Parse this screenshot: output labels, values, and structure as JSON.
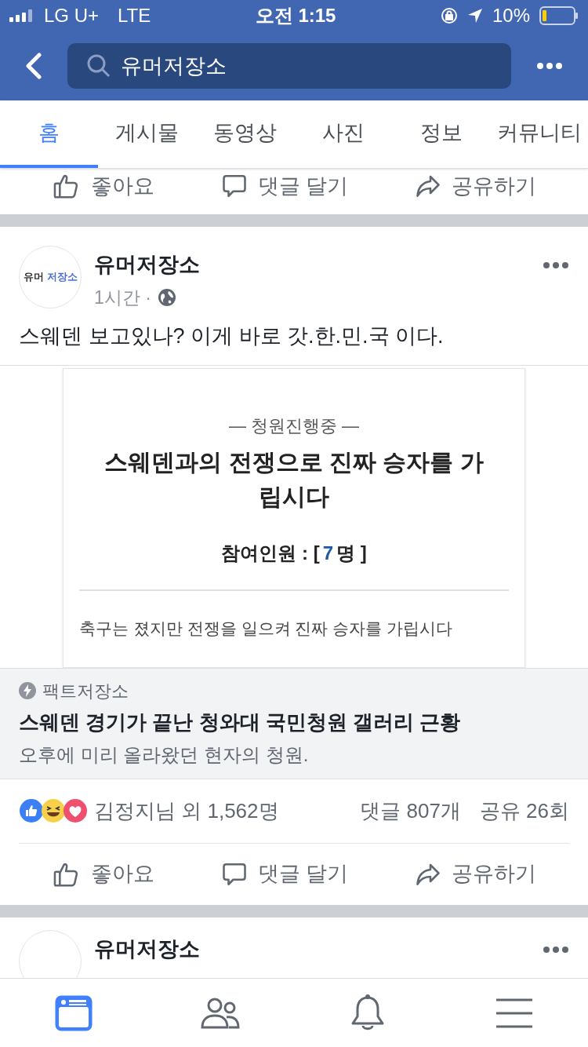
{
  "status_bar": {
    "carrier": "LG U+",
    "network": "LTE",
    "time": "오전 1:15",
    "battery": "10%"
  },
  "search": {
    "value": "유머저장소"
  },
  "tabs": [
    {
      "label": "홈",
      "selected": true
    },
    {
      "label": "게시물",
      "selected": false
    },
    {
      "label": "동영상",
      "selected": false
    },
    {
      "label": "사진",
      "selected": false
    },
    {
      "label": "정보",
      "selected": false
    },
    {
      "label": "커뮤니티",
      "selected": false
    }
  ],
  "previous_actions": [
    {
      "kind": "like",
      "label": "좋아요"
    },
    {
      "kind": "comment",
      "label": "댓글 달기"
    },
    {
      "kind": "share",
      "label": "공유하기"
    }
  ],
  "post": {
    "avatar": {
      "left": "유머",
      "right": "저장소"
    },
    "page_name": "유머저장소",
    "time": "1시간 ·",
    "text": "스웨덴 보고있나? 이게 바로 갓.한.민.국 이다.",
    "image": {
      "status": "— 청원진행중 —",
      "title": "스웨덴과의 전쟁으로 진짜 승자를 가립시다",
      "count_prefix": "참여인원 : [",
      "count": "7",
      "count_suffix": "명 ]",
      "body": "축구는 졌지만 전쟁을 일으켜 진짜 승자를 가립시다"
    },
    "link": {
      "source": "팩트저장소",
      "title": "스웨덴 경기가 끝난 청와대 국민청원 갤러리 근황",
      "subtitle": "오후에 미리 올라왔던 현자의 청원."
    },
    "reactions": "김정지님 외 1,562명",
    "comments": "댓글 807개",
    "shares": "공유 26회",
    "actions": [
      {
        "kind": "like",
        "label": "좋아요"
      },
      {
        "kind": "comment",
        "label": "댓글 달기"
      },
      {
        "kind": "share",
        "label": "공유하기"
      }
    ]
  },
  "next_post": {
    "page_name": "유머저장소"
  },
  "bottom_nav": [
    {
      "kind": "feed",
      "selected": true
    },
    {
      "kind": "friends",
      "selected": false
    },
    {
      "kind": "notifications",
      "selected": false
    },
    {
      "kind": "menu",
      "selected": false
    }
  ]
}
